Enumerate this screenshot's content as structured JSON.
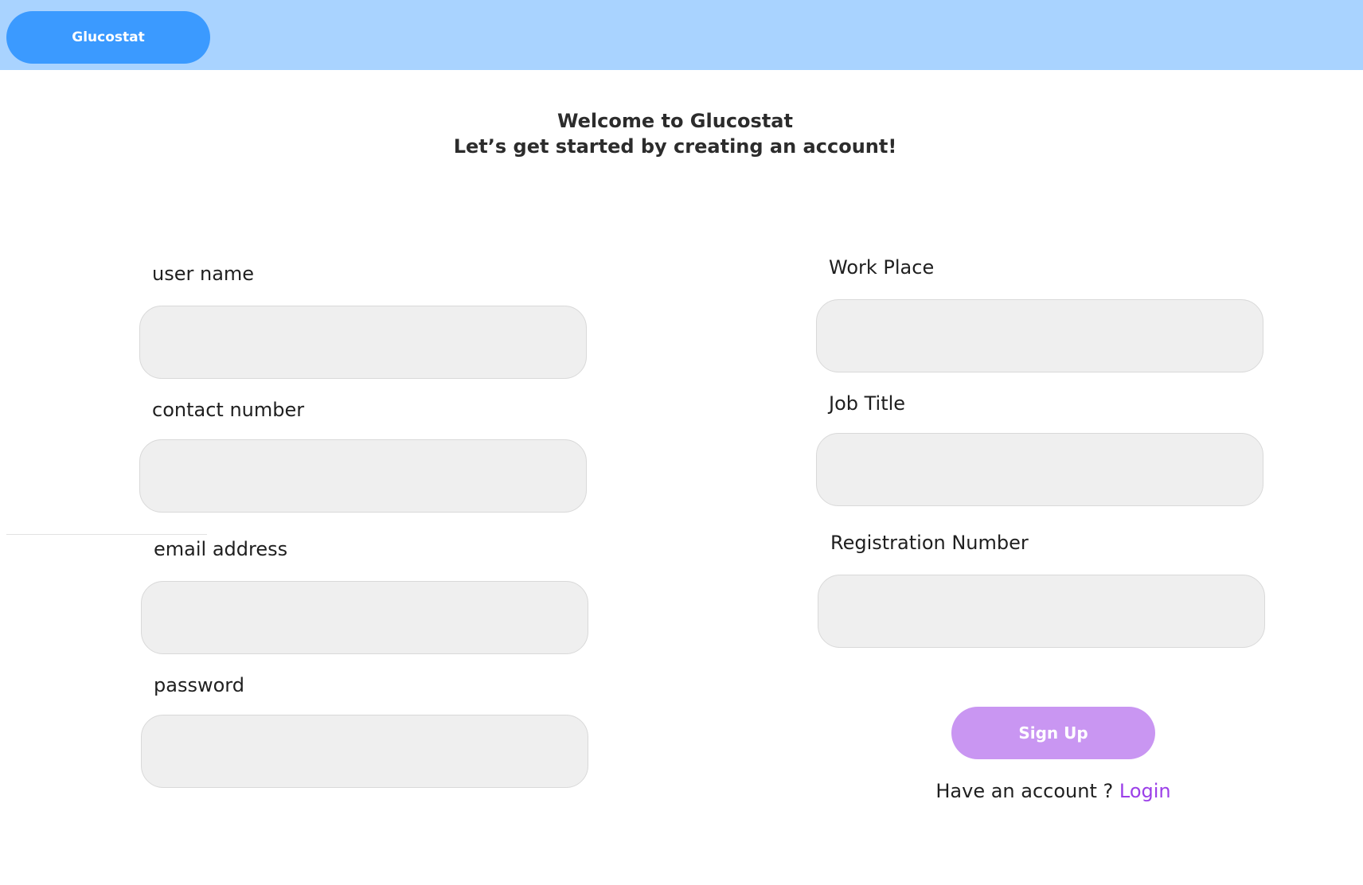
{
  "app": {
    "brand_label": "Glucostat"
  },
  "heading": {
    "line1": "Welcome to Glucostat",
    "line2": "Let’s get started by creating an account!"
  },
  "form": {
    "left_fields": [
      {
        "label": "user name",
        "value": "",
        "placeholder": ""
      },
      {
        "label": "contact number",
        "value": "",
        "placeholder": ""
      },
      {
        "label": "email address",
        "value": "",
        "placeholder": ""
      },
      {
        "label": "password",
        "value": "",
        "placeholder": ""
      }
    ],
    "right_fields": [
      {
        "label": "Work Place",
        "value": "",
        "placeholder": ""
      },
      {
        "label": "Job Title",
        "value": "",
        "placeholder": ""
      },
      {
        "label": "Registration Number",
        "value": "",
        "placeholder": ""
      }
    ],
    "signup_label": "Sign Up",
    "have_account_text": "Have an account ? ",
    "login_label": "Login"
  },
  "colors": {
    "topbar_bg": "#a9d3ff",
    "brand_pill": "#3b9aff",
    "signup_button": "#c996f2",
    "login_link": "#9b3fe8",
    "input_bg": "#efefef"
  }
}
